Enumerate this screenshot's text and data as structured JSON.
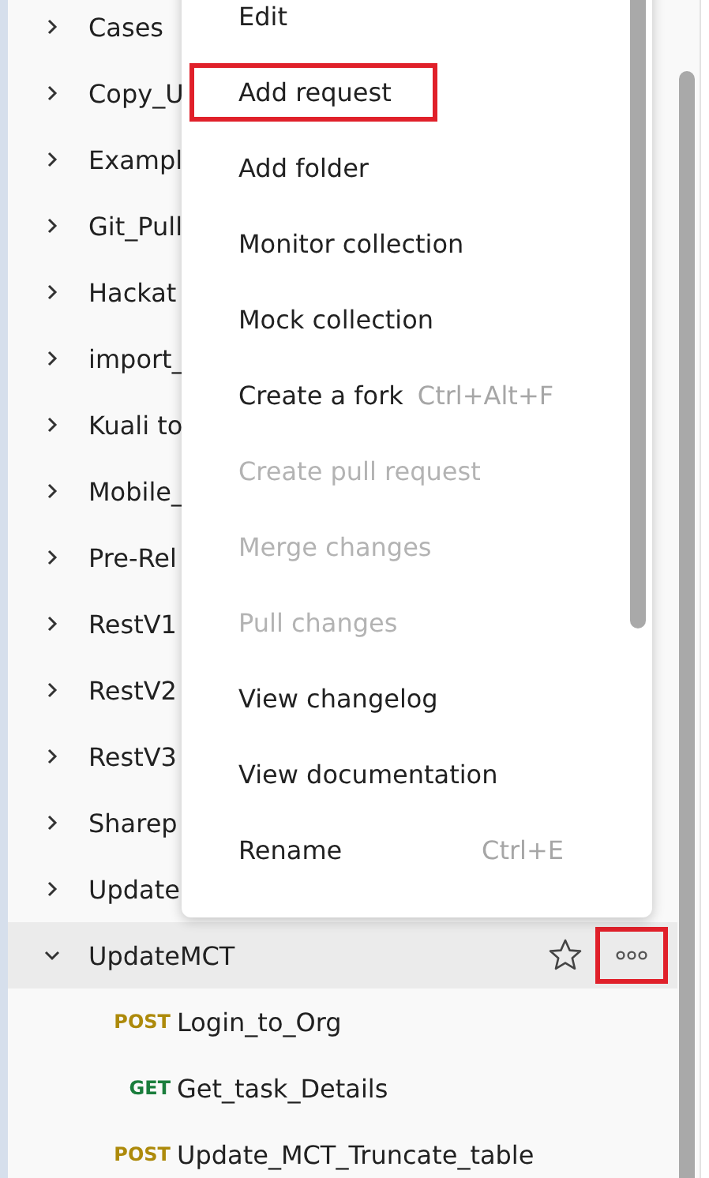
{
  "collections": [
    {
      "name": "Cases",
      "expanded": false,
      "selected": false
    },
    {
      "name": "Copy_U",
      "expanded": false,
      "selected": false
    },
    {
      "name": "Exampl",
      "expanded": false,
      "selected": false
    },
    {
      "name": "Git_Pull",
      "expanded": false,
      "selected": false
    },
    {
      "name": "Hackat",
      "expanded": false,
      "selected": false
    },
    {
      "name": "import_",
      "expanded": false,
      "selected": false
    },
    {
      "name": "Kuali to",
      "expanded": false,
      "selected": false
    },
    {
      "name": "Mobile_",
      "expanded": false,
      "selected": false
    },
    {
      "name": "Pre-Rel",
      "expanded": false,
      "selected": false
    },
    {
      "name": "RestV1",
      "expanded": false,
      "selected": false
    },
    {
      "name": "RestV2",
      "expanded": false,
      "selected": false
    },
    {
      "name": "RestV3",
      "expanded": false,
      "selected": false
    },
    {
      "name": "Sharep",
      "expanded": false,
      "selected": false
    },
    {
      "name": "Update",
      "expanded": false,
      "selected": false
    },
    {
      "name": "UpdateMCT",
      "expanded": true,
      "selected": true,
      "more_highlighted": true,
      "children": [
        {
          "method": "POST",
          "name": "Login_to_Org"
        },
        {
          "method": "GET",
          "name": "Get_task_Details"
        },
        {
          "method": "POST",
          "name": "Update_MCT_Truncate_table"
        }
      ]
    }
  ],
  "context_menu": {
    "items": [
      {
        "label": "Edit",
        "disabled": false,
        "highlighted": false
      },
      {
        "label": "Add request",
        "disabled": false,
        "highlighted": true
      },
      {
        "label": "Add folder",
        "disabled": false,
        "highlighted": false
      },
      {
        "label": "Monitor collection",
        "disabled": false,
        "highlighted": false
      },
      {
        "label": "Mock collection",
        "disabled": false,
        "highlighted": false
      },
      {
        "label": "Create a fork",
        "shortcut": "Ctrl+Alt+F",
        "disabled": false,
        "highlighted": false
      },
      {
        "label": "Create pull request",
        "disabled": true,
        "highlighted": false
      },
      {
        "label": "Merge changes",
        "disabled": true,
        "highlighted": false
      },
      {
        "label": "Pull changes",
        "disabled": true,
        "highlighted": false
      },
      {
        "label": "View changelog",
        "disabled": false,
        "highlighted": false
      },
      {
        "label": "View documentation",
        "disabled": false,
        "highlighted": false
      },
      {
        "label": "Rename",
        "shortcut": "Ctrl+E",
        "disabled": false,
        "highlighted": false
      }
    ]
  }
}
